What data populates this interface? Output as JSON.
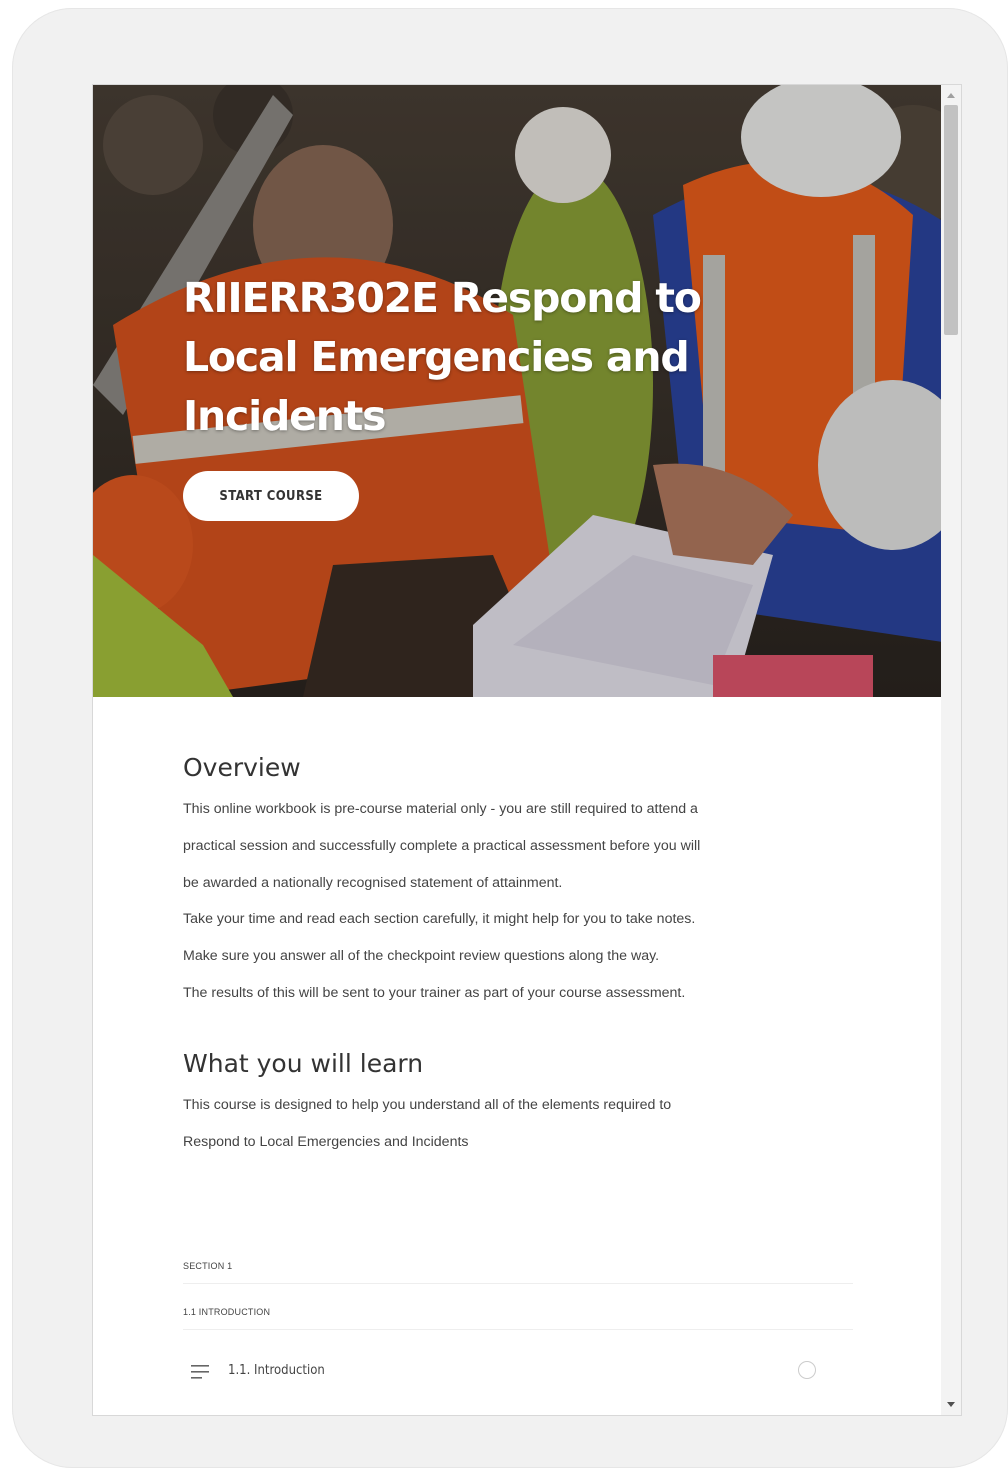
{
  "hero": {
    "title": "RIIERR302E Respond to Local Emergencies and Incidents",
    "start_label": "START COURSE"
  },
  "overview": {
    "heading": "Overview",
    "lines": [
      "This online workbook is pre-course material only - you are still required to attend a",
      "practical session and successfully complete a practical assessment before you will",
      "be awarded a nationally recognised statement of attainment.",
      "Take your time and read each section carefully, it might help for you to take notes.",
      "Make sure you answer all of the checkpoint review questions along the way.",
      "The results of this will be sent to your trainer as part of your course assessment."
    ]
  },
  "learn": {
    "heading": "What you will learn",
    "lines": [
      "This course is designed to help you understand all of the elements required to",
      "Respond to Local Emergencies and Incidents"
    ]
  },
  "outline": {
    "section_label": "SECTION 1",
    "subsection_label": "1.1 INTRODUCTION",
    "lesson_label": "1.1. Introduction"
  },
  "icons": {
    "lesson": "text-lines-icon",
    "status": "incomplete-circle-icon"
  },
  "colors": {
    "tablet_frame": "#f1f1f1",
    "button_bg": "#ffffff",
    "heading_text": "#333333"
  }
}
